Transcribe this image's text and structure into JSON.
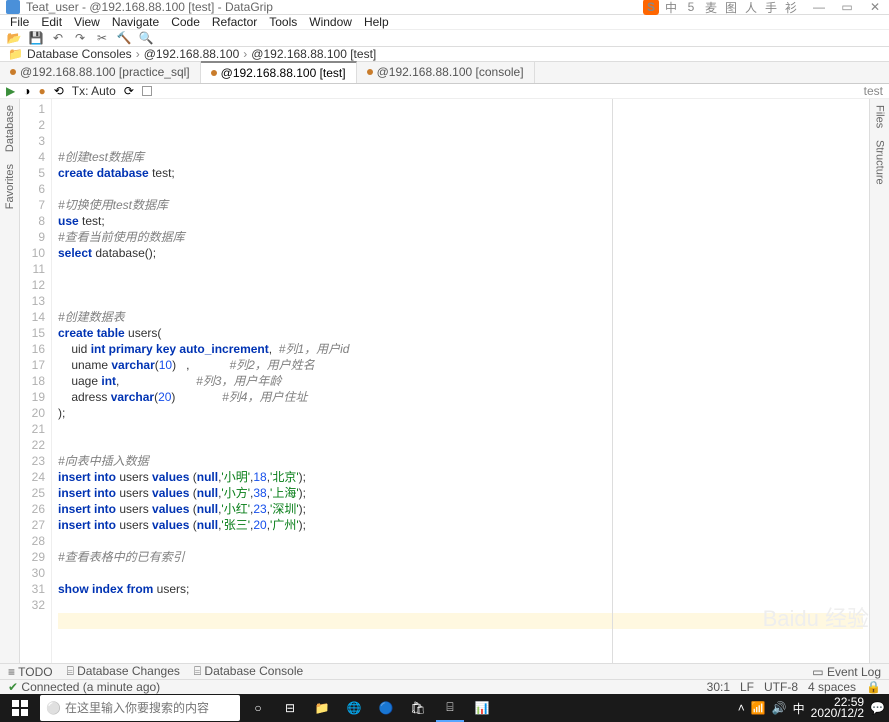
{
  "window": {
    "title": "Teat_user - @192.168.88.100 [test] - DataGrip"
  },
  "tray_icons": [
    "S",
    "中",
    "5",
    "麦",
    "图",
    "人",
    "手",
    "衫"
  ],
  "menus": [
    "File",
    "Edit",
    "View",
    "Navigate",
    "Code",
    "Refactor",
    "Tools",
    "Window",
    "Help"
  ],
  "breadcrumb": {
    "root": "Database Consoles",
    "host": "@192.168.88.100",
    "leaf": "@192.168.88.100 [test]"
  },
  "file_tabs": [
    {
      "label": "@192.168.88.100 [practice_sql]",
      "active": false
    },
    {
      "label": "@192.168.88.100 [test]",
      "active": true
    },
    {
      "label": "@192.168.88.100 [console]",
      "active": false
    }
  ],
  "editor_toolbar": {
    "tx_label": "Tx: Auto",
    "right_tag": "test"
  },
  "left_sidebar": [
    "Database",
    "Favorites"
  ],
  "right_sidebar": [
    "Files",
    "Structure"
  ],
  "lines": [
    [
      {
        "t": "#创建test数据库",
        "c": "cm"
      }
    ],
    [
      {
        "t": "create database",
        "c": "kw"
      },
      {
        "t": " test;",
        "c": "id"
      }
    ],
    [],
    [
      {
        "t": "#切换使用test数据库",
        "c": "cm"
      }
    ],
    [
      {
        "t": "use",
        "c": "kw"
      },
      {
        "t": " test;",
        "c": "id"
      }
    ],
    [
      {
        "t": "#查看当前使用的数据库",
        "c": "cm"
      }
    ],
    [
      {
        "t": "select",
        "c": "kw"
      },
      {
        "t": " ",
        "c": "id"
      },
      {
        "t": "database",
        "c": "id"
      },
      {
        "t": "();",
        "c": "id"
      }
    ],
    [],
    [],
    [],
    [
      {
        "t": "#创建数据表",
        "c": "cm"
      }
    ],
    [
      {
        "t": "create table",
        "c": "kw"
      },
      {
        "t": " users(",
        "c": "id"
      }
    ],
    [
      {
        "t": "    uid ",
        "c": "id"
      },
      {
        "t": "int primary key auto_increment",
        "c": "kw"
      },
      {
        "t": ",  ",
        "c": "id"
      },
      {
        "t": "#列1，用户id",
        "c": "cm"
      }
    ],
    [
      {
        "t": "    uname ",
        "c": "id"
      },
      {
        "t": "varchar",
        "c": "kw"
      },
      {
        "t": "(",
        "c": "id"
      },
      {
        "t": "10",
        "c": "num"
      },
      {
        "t": ")   ,            ",
        "c": "id"
      },
      {
        "t": "#列2，用户姓名",
        "c": "cm"
      }
    ],
    [
      {
        "t": "    uage ",
        "c": "id"
      },
      {
        "t": "int",
        "c": "kw"
      },
      {
        "t": ",                       ",
        "c": "id"
      },
      {
        "t": "#列3，用户年龄",
        "c": "cm"
      }
    ],
    [
      {
        "t": "    adress ",
        "c": "id"
      },
      {
        "t": "varchar",
        "c": "kw"
      },
      {
        "t": "(",
        "c": "id"
      },
      {
        "t": "20",
        "c": "num"
      },
      {
        "t": ")              ",
        "c": "id"
      },
      {
        "t": "#列4，用户住址",
        "c": "cm"
      }
    ],
    [
      {
        "t": ");",
        "c": "id"
      }
    ],
    [],
    [],
    [
      {
        "t": "#向表中插入数据",
        "c": "cm"
      }
    ],
    [
      {
        "t": "insert into",
        "c": "kw"
      },
      {
        "t": " users ",
        "c": "id"
      },
      {
        "t": "values",
        "c": "kw"
      },
      {
        "t": " (",
        "c": "id"
      },
      {
        "t": "null",
        "c": "kw"
      },
      {
        "t": ",",
        "c": "id"
      },
      {
        "t": "'小明'",
        "c": "str"
      },
      {
        "t": ",",
        "c": "id"
      },
      {
        "t": "18",
        "c": "num"
      },
      {
        "t": ",",
        "c": "id"
      },
      {
        "t": "'北京'",
        "c": "str"
      },
      {
        "t": ");",
        "c": "id"
      }
    ],
    [
      {
        "t": "insert into",
        "c": "kw"
      },
      {
        "t": " users ",
        "c": "id"
      },
      {
        "t": "values",
        "c": "kw"
      },
      {
        "t": " (",
        "c": "id"
      },
      {
        "t": "null",
        "c": "kw"
      },
      {
        "t": ",",
        "c": "id"
      },
      {
        "t": "'小方'",
        "c": "str"
      },
      {
        "t": ",",
        "c": "id"
      },
      {
        "t": "38",
        "c": "num"
      },
      {
        "t": ",",
        "c": "id"
      },
      {
        "t": "'上海'",
        "c": "str"
      },
      {
        "t": ");",
        "c": "id"
      }
    ],
    [
      {
        "t": "insert into",
        "c": "kw"
      },
      {
        "t": " users ",
        "c": "id"
      },
      {
        "t": "values",
        "c": "kw"
      },
      {
        "t": " (",
        "c": "id"
      },
      {
        "t": "null",
        "c": "kw"
      },
      {
        "t": ",",
        "c": "id"
      },
      {
        "t": "'小红'",
        "c": "str"
      },
      {
        "t": ",",
        "c": "id"
      },
      {
        "t": "23",
        "c": "num"
      },
      {
        "t": ",",
        "c": "id"
      },
      {
        "t": "'深圳'",
        "c": "str"
      },
      {
        "t": ");",
        "c": "id"
      }
    ],
    [
      {
        "t": "insert into",
        "c": "kw"
      },
      {
        "t": " users ",
        "c": "id"
      },
      {
        "t": "values",
        "c": "kw"
      },
      {
        "t": " (",
        "c": "id"
      },
      {
        "t": "null",
        "c": "kw"
      },
      {
        "t": ",",
        "c": "id"
      },
      {
        "t": "'张三'",
        "c": "str"
      },
      {
        "t": ",",
        "c": "id"
      },
      {
        "t": "20",
        "c": "num"
      },
      {
        "t": ",",
        "c": "id"
      },
      {
        "t": "'广州'",
        "c": "str"
      },
      {
        "t": ");",
        "c": "id"
      }
    ],
    [],
    [
      {
        "t": "#查看表格中的已有索引",
        "c": "cm"
      }
    ],
    [],
    [
      {
        "t": "show index from",
        "c": "kw"
      },
      {
        "t": " users;",
        "c": "id"
      }
    ],
    [],
    [],
    [],
    []
  ],
  "highlight_line": 30,
  "bottom_tabs": {
    "todo": "TODO",
    "db_changes": "Database Changes",
    "db_console": "Database Console",
    "event_log": "Event Log"
  },
  "status": {
    "connected": "Connected (a minute ago)",
    "pos": "30:1",
    "lf": "LF",
    "enc": "UTF-8",
    "spaces": "4 spaces"
  },
  "taskbar": {
    "search_placeholder": "在这里输入你要搜索的内容",
    "time": "22:59",
    "date": "2020/12/2"
  },
  "watermark": "Baidu 经验"
}
